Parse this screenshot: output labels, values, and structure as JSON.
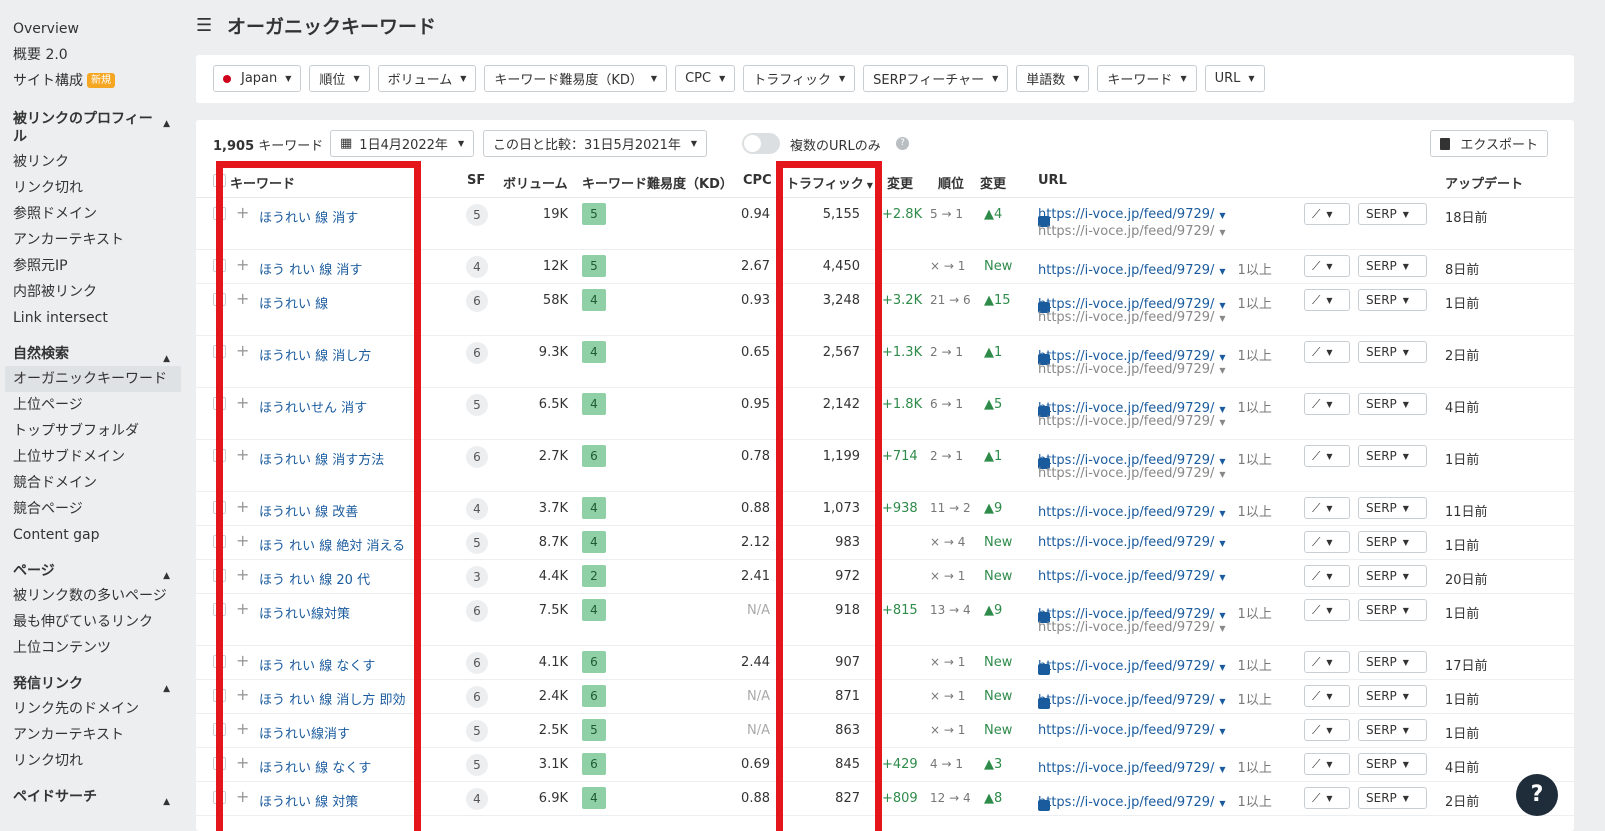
{
  "sidebar": {
    "top_items": [
      {
        "label": "Overview"
      },
      {
        "label": "概要 2.0"
      },
      {
        "label": "サイト構成",
        "badge": "新規"
      }
    ],
    "sections": [
      {
        "title": "被リンクのプロフィール",
        "items": [
          "被リンク",
          "リンク切れ",
          "参照ドメイン",
          "アンカーテキスト",
          "参照元IP",
          "内部被リンク",
          "Link intersect"
        ]
      },
      {
        "title": "自然検索",
        "items": [
          "オーガニックキーワード",
          "上位ページ",
          "トップサブフォルダ",
          "上位サブドメイン",
          "競合ドメイン",
          "競合ページ",
          "Content gap"
        ]
      },
      {
        "title": "ページ",
        "items": [
          "被リンク数の多いページ",
          "最も伸びているリンク",
          "上位コンテンツ"
        ]
      },
      {
        "title": "発信リンク",
        "items": [
          "リンク先のドメイン",
          "アンカーテキスト",
          "リンク切れ"
        ]
      },
      {
        "title": "ペイドサーチ",
        "items": []
      }
    ]
  },
  "header": {
    "title": "オーガニックキーワード"
  },
  "filters": [
    "Japan",
    "順位",
    "ボリューム",
    "キーワード難易度（KD）",
    "CPC",
    "トラフィック",
    "SERPフィーチャー",
    "単語数",
    "キーワード",
    "URL"
  ],
  "toolbar": {
    "count_num": "1,905",
    "count_label": "キーワード",
    "date": "1日4月2022年",
    "compare": "この日と比較：31日5月2021年",
    "toggle_label": "複数のURLのみ",
    "export": "エクスポート"
  },
  "table": {
    "headers": {
      "keyword": "キーワード",
      "sf": "SF",
      "volume": "ボリューム",
      "kd": "キーワード難易度（KD）",
      "cpc": "CPC",
      "traffic": "トラフィック",
      "change": "変更",
      "position": "順位",
      "pos_change": "変更",
      "url": "URL",
      "updated": "アップデート"
    },
    "url_value": "https://i-voce.jp/feed/9729/",
    "more_label": "1以上",
    "serp_label": "SERP",
    "rows": [
      {
        "kw": "ほうれい 線 消す",
        "sf": "5",
        "vol": "19K",
        "kd": "5",
        "cpc": "0.94",
        "traffic": "5,155",
        "chg": "+2.8K",
        "pos": "5 → 1",
        "pchg": "▲4",
        "img": true,
        "two": true,
        "more": false,
        "upd": "18日前"
      },
      {
        "kw": "ほう れい 線 消す",
        "sf": "4",
        "vol": "12K",
        "kd": "5",
        "cpc": "2.67",
        "traffic": "4,450",
        "chg": "",
        "pos": "× → 1",
        "pchg": "New",
        "img": false,
        "two": false,
        "more": true,
        "upd": "8日前"
      },
      {
        "kw": "ほうれい 線",
        "sf": "6",
        "vol": "58K",
        "kd": "4",
        "cpc": "0.93",
        "traffic": "3,248",
        "chg": "+3.2K",
        "pos": "21 → 6",
        "pchg": "▲15",
        "img": true,
        "two": true,
        "more": true,
        "upd": "1日前"
      },
      {
        "kw": "ほうれい 線 消し方",
        "sf": "6",
        "vol": "9.3K",
        "kd": "4",
        "cpc": "0.65",
        "traffic": "2,567",
        "chg": "+1.3K",
        "pos": "2 → 1",
        "pchg": "▲1",
        "img": true,
        "two": true,
        "more": true,
        "upd": "2日前"
      },
      {
        "kw": "ほうれいせん 消す",
        "sf": "5",
        "vol": "6.5K",
        "kd": "4",
        "cpc": "0.95",
        "traffic": "2,142",
        "chg": "+1.8K",
        "pos": "6 → 1",
        "pchg": "▲5",
        "img": true,
        "two": true,
        "more": true,
        "upd": "4日前"
      },
      {
        "kw": "ほうれい 線 消す方法",
        "sf": "6",
        "vol": "2.7K",
        "kd": "6",
        "cpc": "0.78",
        "traffic": "1,199",
        "chg": "+714",
        "pos": "2 → 1",
        "pchg": "▲1",
        "img": true,
        "two": true,
        "more": true,
        "upd": "1日前"
      },
      {
        "kw": "ほうれい 線 改善",
        "sf": "4",
        "vol": "3.7K",
        "kd": "4",
        "cpc": "0.88",
        "traffic": "1,073",
        "chg": "+938",
        "pos": "11 → 2",
        "pchg": "▲9",
        "img": false,
        "two": false,
        "more": true,
        "upd": "11日前"
      },
      {
        "kw": "ほう れい 線 絶対 消える",
        "sf": "5",
        "vol": "8.7K",
        "kd": "4",
        "cpc": "2.12",
        "traffic": "983",
        "chg": "",
        "pos": "× → 4",
        "pchg": "New",
        "img": false,
        "two": false,
        "more": false,
        "upd": "1日前"
      },
      {
        "kw": "ほう れい 線 20 代",
        "sf": "3",
        "vol": "4.4K",
        "kd": "2",
        "cpc": "2.41",
        "traffic": "972",
        "chg": "",
        "pos": "× → 1",
        "pchg": "New",
        "img": false,
        "two": false,
        "more": false,
        "upd": "20日前"
      },
      {
        "kw": "ほうれい線対策",
        "sf": "6",
        "vol": "7.5K",
        "kd": "4",
        "cpc": "N/A",
        "traffic": "918",
        "chg": "+815",
        "pos": "13 → 4",
        "pchg": "▲9",
        "img": true,
        "two": true,
        "more": true,
        "upd": "1日前"
      },
      {
        "kw": "ほう れい 線 なくす",
        "sf": "6",
        "vol": "4.1K",
        "kd": "6",
        "cpc": "2.44",
        "traffic": "907",
        "chg": "",
        "pos": "× → 1",
        "pchg": "New",
        "img": true,
        "two": false,
        "more": true,
        "upd": "17日前"
      },
      {
        "kw": "ほう れい 線 消し方 即効",
        "sf": "6",
        "vol": "2.4K",
        "kd": "6",
        "cpc": "N/A",
        "traffic": "871",
        "chg": "",
        "pos": "× → 1",
        "pchg": "New",
        "img": true,
        "two": false,
        "more": true,
        "upd": "1日前"
      },
      {
        "kw": "ほうれい線消す",
        "sf": "5",
        "vol": "2.5K",
        "kd": "5",
        "cpc": "N/A",
        "traffic": "863",
        "chg": "",
        "pos": "× → 1",
        "pchg": "New",
        "img": false,
        "two": false,
        "more": false,
        "upd": "1日前"
      },
      {
        "kw": "ほうれい 線 なくす",
        "sf": "5",
        "vol": "3.1K",
        "kd": "6",
        "cpc": "0.69",
        "traffic": "845",
        "chg": "+429",
        "pos": "4 → 1",
        "pchg": "▲3",
        "img": false,
        "two": false,
        "more": true,
        "upd": "4日前"
      },
      {
        "kw": "ほうれい 線 対策",
        "sf": "4",
        "vol": "6.9K",
        "kd": "4",
        "cpc": "0.88",
        "traffic": "827",
        "chg": "+809",
        "pos": "12 → 4",
        "pchg": "▲8",
        "img": true,
        "two": false,
        "more": true,
        "upd": "2日前"
      }
    ]
  },
  "colors": {
    "highlight": "#e4161c",
    "kd_green": "#8fd0a6",
    "link": "#1a5b9e",
    "positive": "#2e8b4a"
  }
}
